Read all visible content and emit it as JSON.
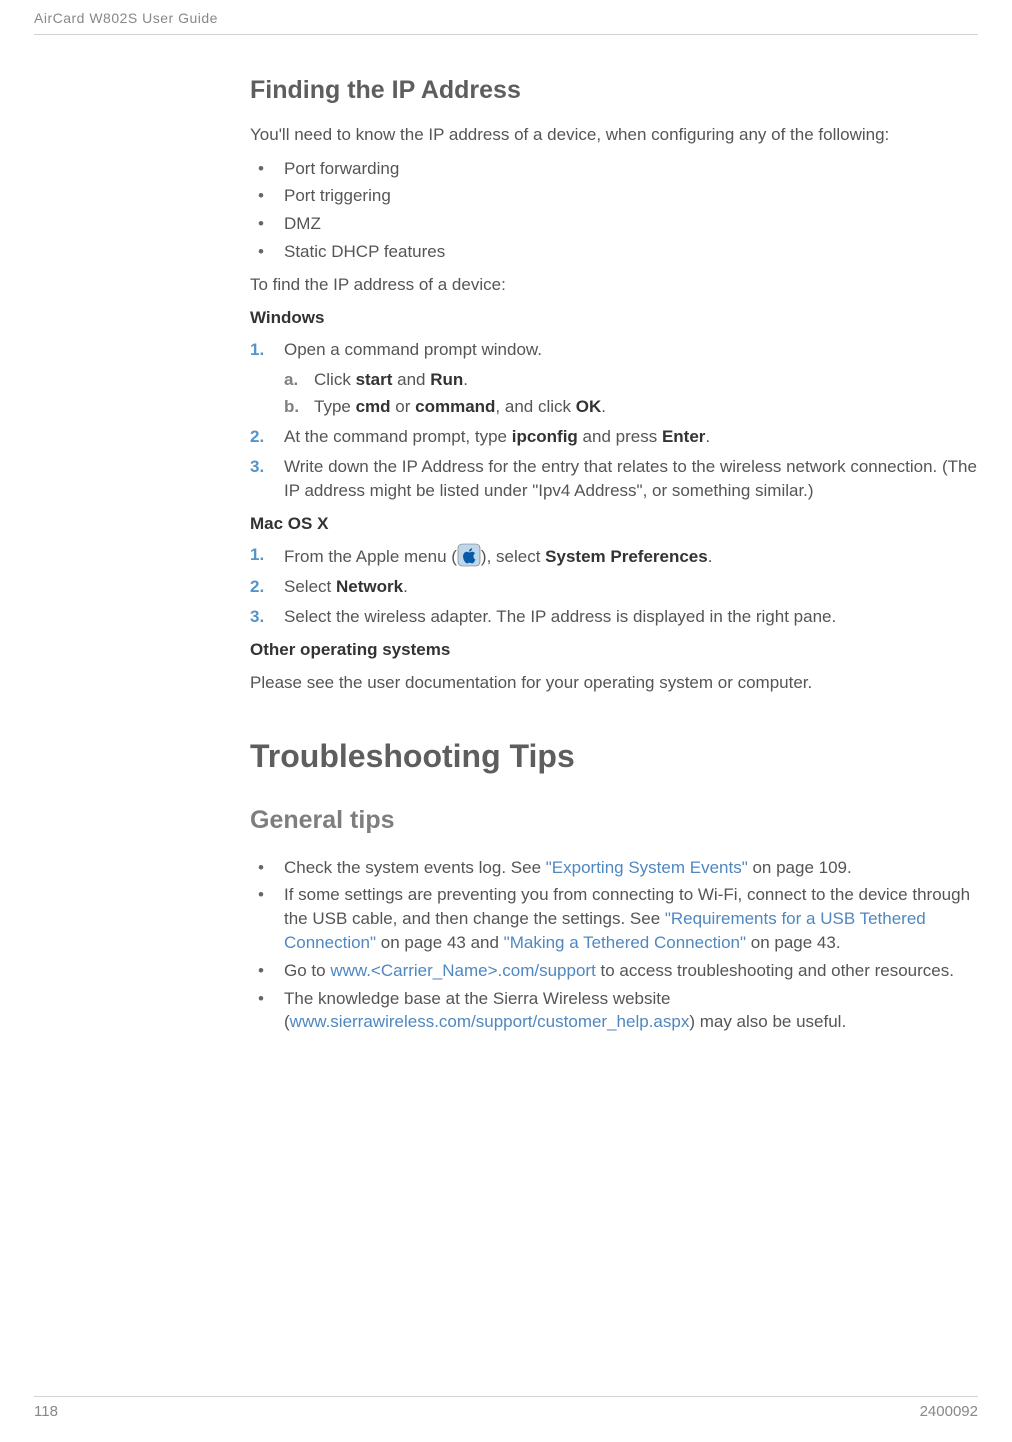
{
  "header": {
    "doc_title": "AirCard W802S User Guide"
  },
  "section1": {
    "title": "Finding the IP Address",
    "intro": "You'll need to know the IP address of a device, when configuring any of the following:",
    "bullets": [
      "Port forwarding",
      "Port triggering",
      "DMZ",
      "Static DHCP features"
    ],
    "lead2": "To find the IP address of a device:",
    "windows_label": "Windows",
    "win_step1": "Open a command prompt window.",
    "win_step1a_pre": "Click ",
    "win_step1a_b1": "start",
    "win_step1a_mid": " and ",
    "win_step1a_b2": "Run",
    "win_step1a_post": ".",
    "win_step1b_pre": "Type ",
    "win_step1b_b1": "cmd",
    "win_step1b_mid": " or ",
    "win_step1b_b2": "command",
    "win_step1b_mid2": ", and click ",
    "win_step1b_b3": "OK",
    "win_step1b_post": ".",
    "win_step2_pre": "At the command prompt, type ",
    "win_step2_b1": "ipconfig",
    "win_step2_mid": " and press ",
    "win_step2_b2": "Enter",
    "win_step2_post": ".",
    "win_step3": "Write down the IP Address for the entry that relates to the wireless network connection. (The IP address might be listed under \"Ipv4 Address\", or something similar.)",
    "mac_label": "Mac OS X",
    "mac_step1_pre": "From the Apple menu (",
    "mac_step1_mid": "), select ",
    "mac_step1_b": "System Preferences",
    "mac_step1_post": ".",
    "mac_step2_pre": "Select ",
    "mac_step2_b": "Network",
    "mac_step2_post": ".",
    "mac_step3": "Select the wireless adapter. The IP address is displayed in the right pane.",
    "other_label": "Other operating systems",
    "other_text": "Please see the user documentation for your operating system or computer."
  },
  "section2": {
    "title": "Troubleshooting Tips",
    "subtitle": "General tips",
    "b1_pre": "Check the system events log. See ",
    "b1_link": "\"Exporting System Events\"",
    "b1_post": " on page 109.",
    "b2_pre": "If some settings are preventing you from connecting to Wi-Fi, connect to the device through the USB cable, and then change the settings. See ",
    "b2_link1": "\"Requirements for a USB Tethered Connection\"",
    "b2_mid": " on page 43 and ",
    "b2_link2": "\"Making a Tethered Connection\"",
    "b2_post": " on page 43.",
    "b3_pre": "Go to  ",
    "b3_link": "www.<Carrier_Name>.com/support",
    "b3_post": " to access troubleshooting and other resources.",
    "b4_pre": "The knowledge base at the Sierra Wireless website (",
    "b4_link": "www.sierrawireless.com/support/customer_help.aspx",
    "b4_post": ") may also be useful."
  },
  "footer": {
    "page": "118",
    "docid": "2400092"
  },
  "icons": {
    "apple": "apple-icon"
  }
}
